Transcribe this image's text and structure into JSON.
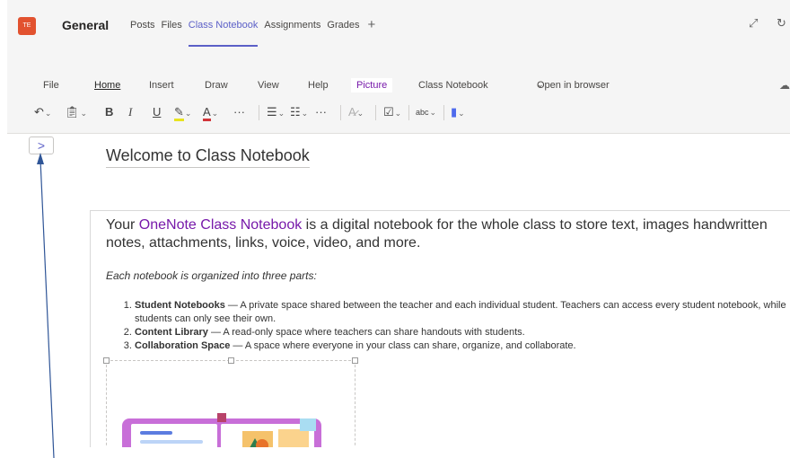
{
  "header": {
    "team_initials": "TE",
    "channel": "General",
    "tabs": [
      {
        "label": "Posts"
      },
      {
        "label": "Files"
      },
      {
        "label": "Class Notebook",
        "active": true
      },
      {
        "label": "Assignments"
      },
      {
        "label": "Grades"
      }
    ],
    "add_tab_icon": "+",
    "expand_icon": "expand-icon",
    "refresh_icon": "refresh-icon"
  },
  "ribbon": {
    "menu": [
      "File",
      "Home",
      "Insert",
      "Draw",
      "View",
      "Help",
      "Picture",
      "Class Notebook",
      "Open in browser"
    ],
    "active_menu": "Home",
    "highlighted_menu": "Picture",
    "toolbar": {
      "bold": "B",
      "italic": "I",
      "underline": "U",
      "more": "···",
      "spelling": "abc"
    }
  },
  "page": {
    "title": "Welcome to Class Notebook",
    "intro_prefix": "Your ",
    "intro_link": "OneNote Class Notebook",
    "intro_suffix": " is a digital notebook for the whole class to store text, images handwritten notes, attachments, links, voice, video, and more.",
    "organized": "Each notebook is organized into three parts:",
    "parts": [
      {
        "title": "Student Notebooks",
        "text": " — A private space shared between the teacher and each individual student. Teachers can access every student notebook, while students can only see their own."
      },
      {
        "title": "Content Library",
        "text": " — A read-only space where teachers can share handouts with students."
      },
      {
        "title": "Collaboration Space",
        "text": " —  A space where everyone in your class can share, organize, and collaborate."
      }
    ]
  },
  "colors": {
    "accent": "#5b5fc7",
    "onenote_purple": "#7719aa",
    "team_avatar": "#e2522f",
    "annotation_arrow": "#2f5597"
  }
}
